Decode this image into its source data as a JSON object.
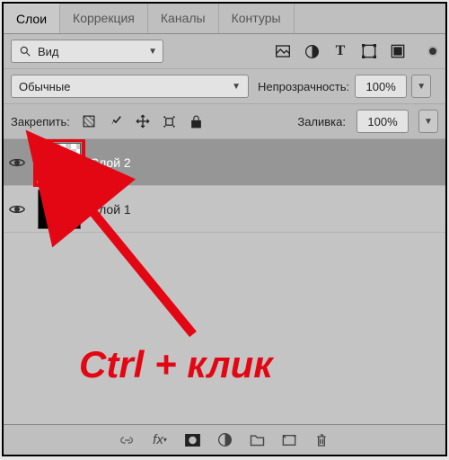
{
  "tabs": {
    "layers": "Слои",
    "adjustments": "Коррекция",
    "channels": "Каналы",
    "paths": "Контуры"
  },
  "kind": {
    "label": "Вид"
  },
  "blend": {
    "mode": "Обычные",
    "opacity_label": "Непрозрачность:",
    "opacity_value": "100%"
  },
  "lock": {
    "label": "Закрепить:",
    "fill_label": "Заливка:",
    "fill_value": "100%"
  },
  "layers": [
    {
      "name": "Слой 2",
      "selected": true,
      "thumb": "flower"
    },
    {
      "name": "Слой 1",
      "selected": false,
      "thumb": "black"
    }
  ],
  "annotation": "Ctrl + клик",
  "icons": {
    "search": "search-icon",
    "image": "image-icon",
    "adjust": "adjust-icon",
    "type": "type-icon",
    "shape": "shape-icon",
    "smart": "smart-icon",
    "link": "link-icon",
    "fx": "fx-icon",
    "mask": "mask-icon",
    "newfill": "newfill-icon",
    "group": "group-icon",
    "new": "new-icon",
    "trash": "trash-icon"
  }
}
